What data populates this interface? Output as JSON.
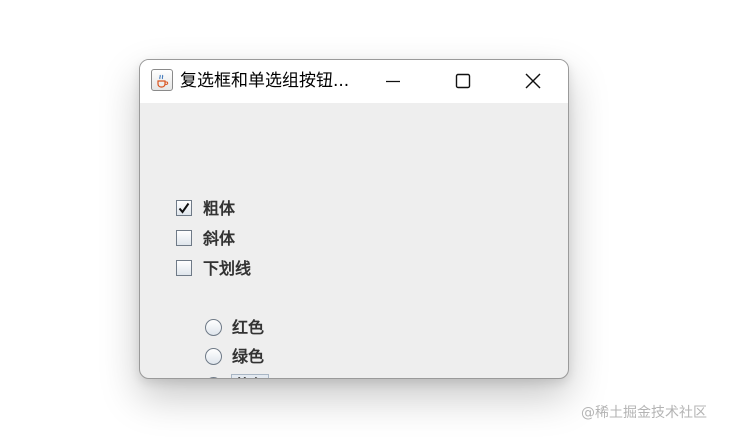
{
  "window": {
    "title": "复选框和单选组按钮...",
    "icon": "java-cup-icon",
    "controls": {
      "minimize": "minimize-icon",
      "maximize": "maximize-icon",
      "close": "close-icon"
    }
  },
  "checkboxes": [
    {
      "label": "粗体",
      "checked": true
    },
    {
      "label": "斜体",
      "checked": false
    },
    {
      "label": "下划线",
      "checked": false
    }
  ],
  "radios": [
    {
      "label": "红色",
      "selected": false
    },
    {
      "label": "绿色",
      "selected": false
    },
    {
      "label": "蓝色",
      "selected": true,
      "focused": true
    }
  ],
  "watermark": "@稀土掘金技术社区",
  "colors": {
    "window_bg": "#eeeeee",
    "titlebar_bg": "#ffffff",
    "label_text": "#333333",
    "watermark": "#b4b4b4"
  }
}
